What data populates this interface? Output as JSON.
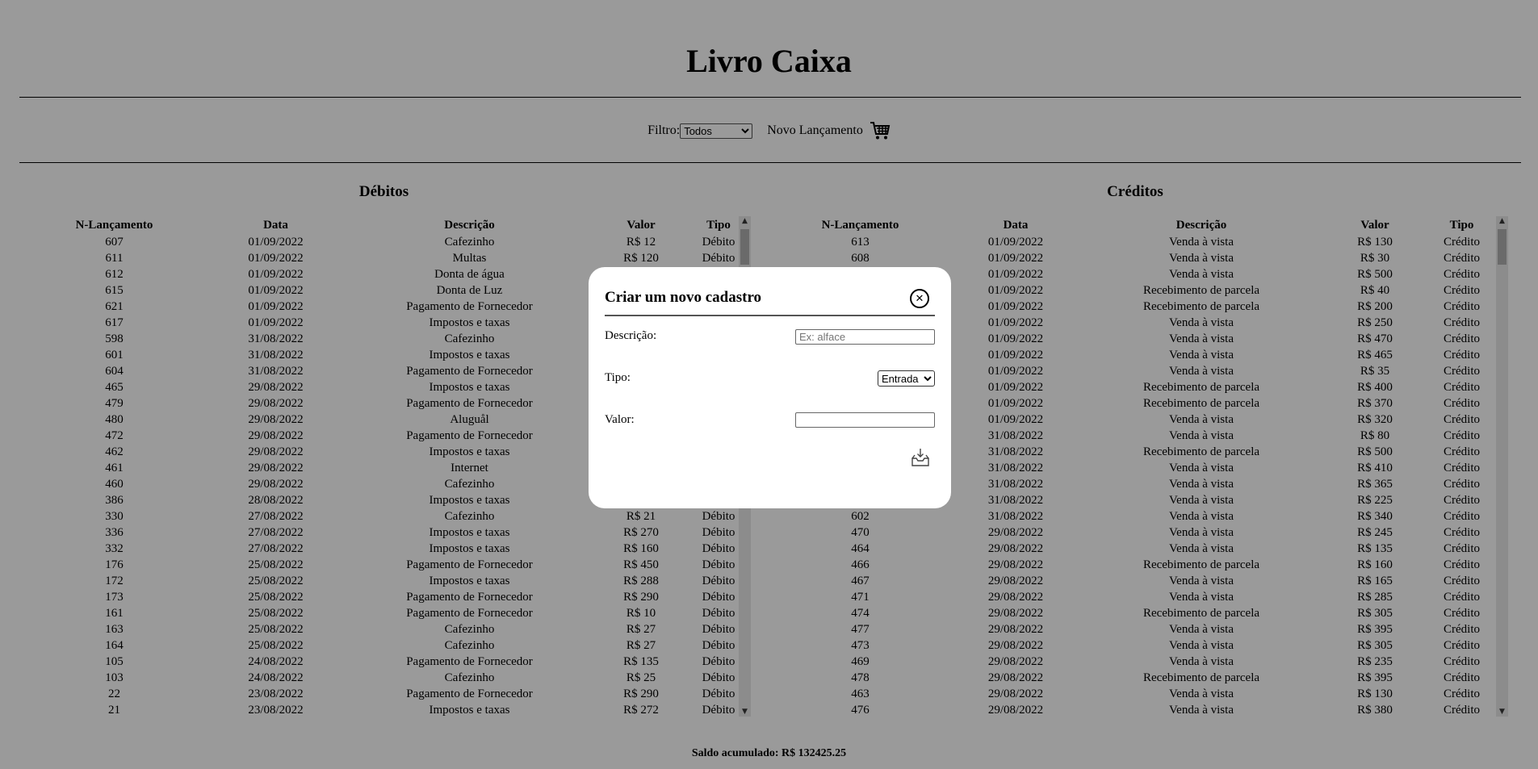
{
  "header": {
    "title": "Livro Caixa"
  },
  "toolbar": {
    "filter_label": "Filtro:",
    "filter_selected": "Todos",
    "new_entry_label": "Novo Lançamento",
    "new_entry_icon": "cart-icon"
  },
  "debits": {
    "title": "Débitos",
    "columns": [
      "N-Lançamento",
      "Data",
      "Descrição",
      "Valor",
      "Tipo"
    ],
    "rows": [
      [
        "607",
        "01/09/2022",
        "Cafezinho",
        "R$ 12",
        "Débito"
      ],
      [
        "611",
        "01/09/2022",
        "Multas",
        "R$ 120",
        "Débito"
      ],
      [
        "612",
        "01/09/2022",
        "Donta de água",
        "",
        ""
      ],
      [
        "615",
        "01/09/2022",
        "Donta de Luz",
        "",
        ""
      ],
      [
        "621",
        "01/09/2022",
        "Pagamento de Fornecedor",
        "",
        ""
      ],
      [
        "617",
        "01/09/2022",
        "Impostos e taxas",
        "",
        ""
      ],
      [
        "598",
        "31/08/2022",
        "Cafezinho",
        "",
        ""
      ],
      [
        "601",
        "31/08/2022",
        "Impostos e taxas",
        "",
        ""
      ],
      [
        "604",
        "31/08/2022",
        "Pagamento de Fornecedor",
        "",
        ""
      ],
      [
        "465",
        "29/08/2022",
        "Impostos e taxas",
        "",
        ""
      ],
      [
        "479",
        "29/08/2022",
        "Pagamento de Fornecedor",
        "",
        ""
      ],
      [
        "480",
        "29/08/2022",
        "Aluguål",
        "",
        ""
      ],
      [
        "472",
        "29/08/2022",
        "Pagamento de Fornecedor",
        "",
        ""
      ],
      [
        "462",
        "29/08/2022",
        "Impostos e taxas",
        "",
        ""
      ],
      [
        "461",
        "29/08/2022",
        "Internet",
        "",
        ""
      ],
      [
        "460",
        "29/08/2022",
        "Cafezinho",
        "",
        ""
      ],
      [
        "386",
        "28/08/2022",
        "Impostos e taxas",
        "",
        ""
      ],
      [
        "330",
        "27/08/2022",
        "Cafezinho",
        "R$ 21",
        "Débito"
      ],
      [
        "336",
        "27/08/2022",
        "Impostos e taxas",
        "R$ 270",
        "Débito"
      ],
      [
        "332",
        "27/08/2022",
        "Impostos e taxas",
        "R$ 160",
        "Débito"
      ],
      [
        "176",
        "25/08/2022",
        "Pagamento de Fornecedor",
        "R$ 450",
        "Débito"
      ],
      [
        "172",
        "25/08/2022",
        "Impostos e taxas",
        "R$ 288",
        "Débito"
      ],
      [
        "173",
        "25/08/2022",
        "Pagamento de Fornecedor",
        "R$ 290",
        "Débito"
      ],
      [
        "161",
        "25/08/2022",
        "Pagamento de Fornecedor",
        "R$ 10",
        "Débito"
      ],
      [
        "163",
        "25/08/2022",
        "Cafezinho",
        "R$ 27",
        "Débito"
      ],
      [
        "164",
        "25/08/2022",
        "Cafezinho",
        "R$ 27",
        "Débito"
      ],
      [
        "105",
        "24/08/2022",
        "Pagamento de Fornecedor",
        "R$ 135",
        "Débito"
      ],
      [
        "103",
        "24/08/2022",
        "Cafezinho",
        "R$ 25",
        "Débito"
      ],
      [
        "22",
        "23/08/2022",
        "Pagamento de Fornecedor",
        "R$ 290",
        "Débito"
      ],
      [
        "21",
        "23/08/2022",
        "Impostos e taxas",
        "R$ 272",
        "Débito"
      ]
    ]
  },
  "credits": {
    "title": "Créditos",
    "columns": [
      "N-Lançamento",
      "Data",
      "Descrição",
      "Valor",
      "Tipo"
    ],
    "rows": [
      [
        "613",
        "01/09/2022",
        "Venda à vista",
        "R$ 130",
        "Crédito"
      ],
      [
        "608",
        "01/09/2022",
        "Venda à vista",
        "R$ 30",
        "Crédito"
      ],
      [
        "",
        "01/09/2022",
        "Venda à vista",
        "R$ 500",
        "Crédito"
      ],
      [
        "",
        "01/09/2022",
        "Recebimento de parcela",
        "R$ 40",
        "Crédito"
      ],
      [
        "",
        "01/09/2022",
        "Recebimento de parcela",
        "R$ 200",
        "Crédito"
      ],
      [
        "",
        "01/09/2022",
        "Venda à vista",
        "R$ 250",
        "Crédito"
      ],
      [
        "",
        "01/09/2022",
        "Venda à vista",
        "R$ 470",
        "Crédito"
      ],
      [
        "",
        "01/09/2022",
        "Venda à vista",
        "R$ 465",
        "Crédito"
      ],
      [
        "",
        "01/09/2022",
        "Venda à vista",
        "R$ 35",
        "Crédito"
      ],
      [
        "",
        "01/09/2022",
        "Recebimento de parcela",
        "R$ 400",
        "Crédito"
      ],
      [
        "",
        "01/09/2022",
        "Recebimento de parcela",
        "R$ 370",
        "Crédito"
      ],
      [
        "",
        "01/09/2022",
        "Venda à vista",
        "R$ 320",
        "Crédito"
      ],
      [
        "",
        "31/08/2022",
        "Venda à vista",
        "R$ 80",
        "Crédito"
      ],
      [
        "",
        "31/08/2022",
        "Recebimento de parcela",
        "R$ 500",
        "Crédito"
      ],
      [
        "",
        "31/08/2022",
        "Venda à vista",
        "R$ 410",
        "Crédito"
      ],
      [
        "",
        "31/08/2022",
        "Venda à vista",
        "R$ 365",
        "Crédito"
      ],
      [
        "",
        "31/08/2022",
        "Venda à vista",
        "R$ 225",
        "Crédito"
      ],
      [
        "602",
        "31/08/2022",
        "Venda à vista",
        "R$ 340",
        "Crédito"
      ],
      [
        "470",
        "29/08/2022",
        "Venda à vista",
        "R$ 245",
        "Crédito"
      ],
      [
        "464",
        "29/08/2022",
        "Venda à vista",
        "R$ 135",
        "Crédito"
      ],
      [
        "466",
        "29/08/2022",
        "Recebimento de parcela",
        "R$ 160",
        "Crédito"
      ],
      [
        "467",
        "29/08/2022",
        "Venda à vista",
        "R$ 165",
        "Crédito"
      ],
      [
        "471",
        "29/08/2022",
        "Venda à vista",
        "R$ 285",
        "Crédito"
      ],
      [
        "474",
        "29/08/2022",
        "Recebimento de parcela",
        "R$ 305",
        "Crédito"
      ],
      [
        "477",
        "29/08/2022",
        "Venda à vista",
        "R$ 395",
        "Crédito"
      ],
      [
        "473",
        "29/08/2022",
        "Venda à vista",
        "R$ 305",
        "Crédito"
      ],
      [
        "469",
        "29/08/2022",
        "Venda à vista",
        "R$ 235",
        "Crédito"
      ],
      [
        "478",
        "29/08/2022",
        "Recebimento de parcela",
        "R$ 395",
        "Crédito"
      ],
      [
        "463",
        "29/08/2022",
        "Venda à vista",
        "R$ 130",
        "Crédito"
      ],
      [
        "476",
        "29/08/2022",
        "Venda à vista",
        "R$ 380",
        "Crédito"
      ]
    ]
  },
  "footer": {
    "balance": "Saldo acumulado: R$ 132425.25"
  },
  "modal": {
    "title": "Criar um novo cadastro",
    "close_icon": "close-icon",
    "description_label": "Descrição:",
    "description_placeholder": "Ex: alface",
    "description_value": "",
    "type_label": "Tipo:",
    "type_selected": "Entrada",
    "value_label": "Valor:",
    "value_value": "",
    "save_icon": "save-inbox-icon"
  },
  "colors": {
    "background": "#9a9a9a",
    "modal": "#ffffff"
  }
}
